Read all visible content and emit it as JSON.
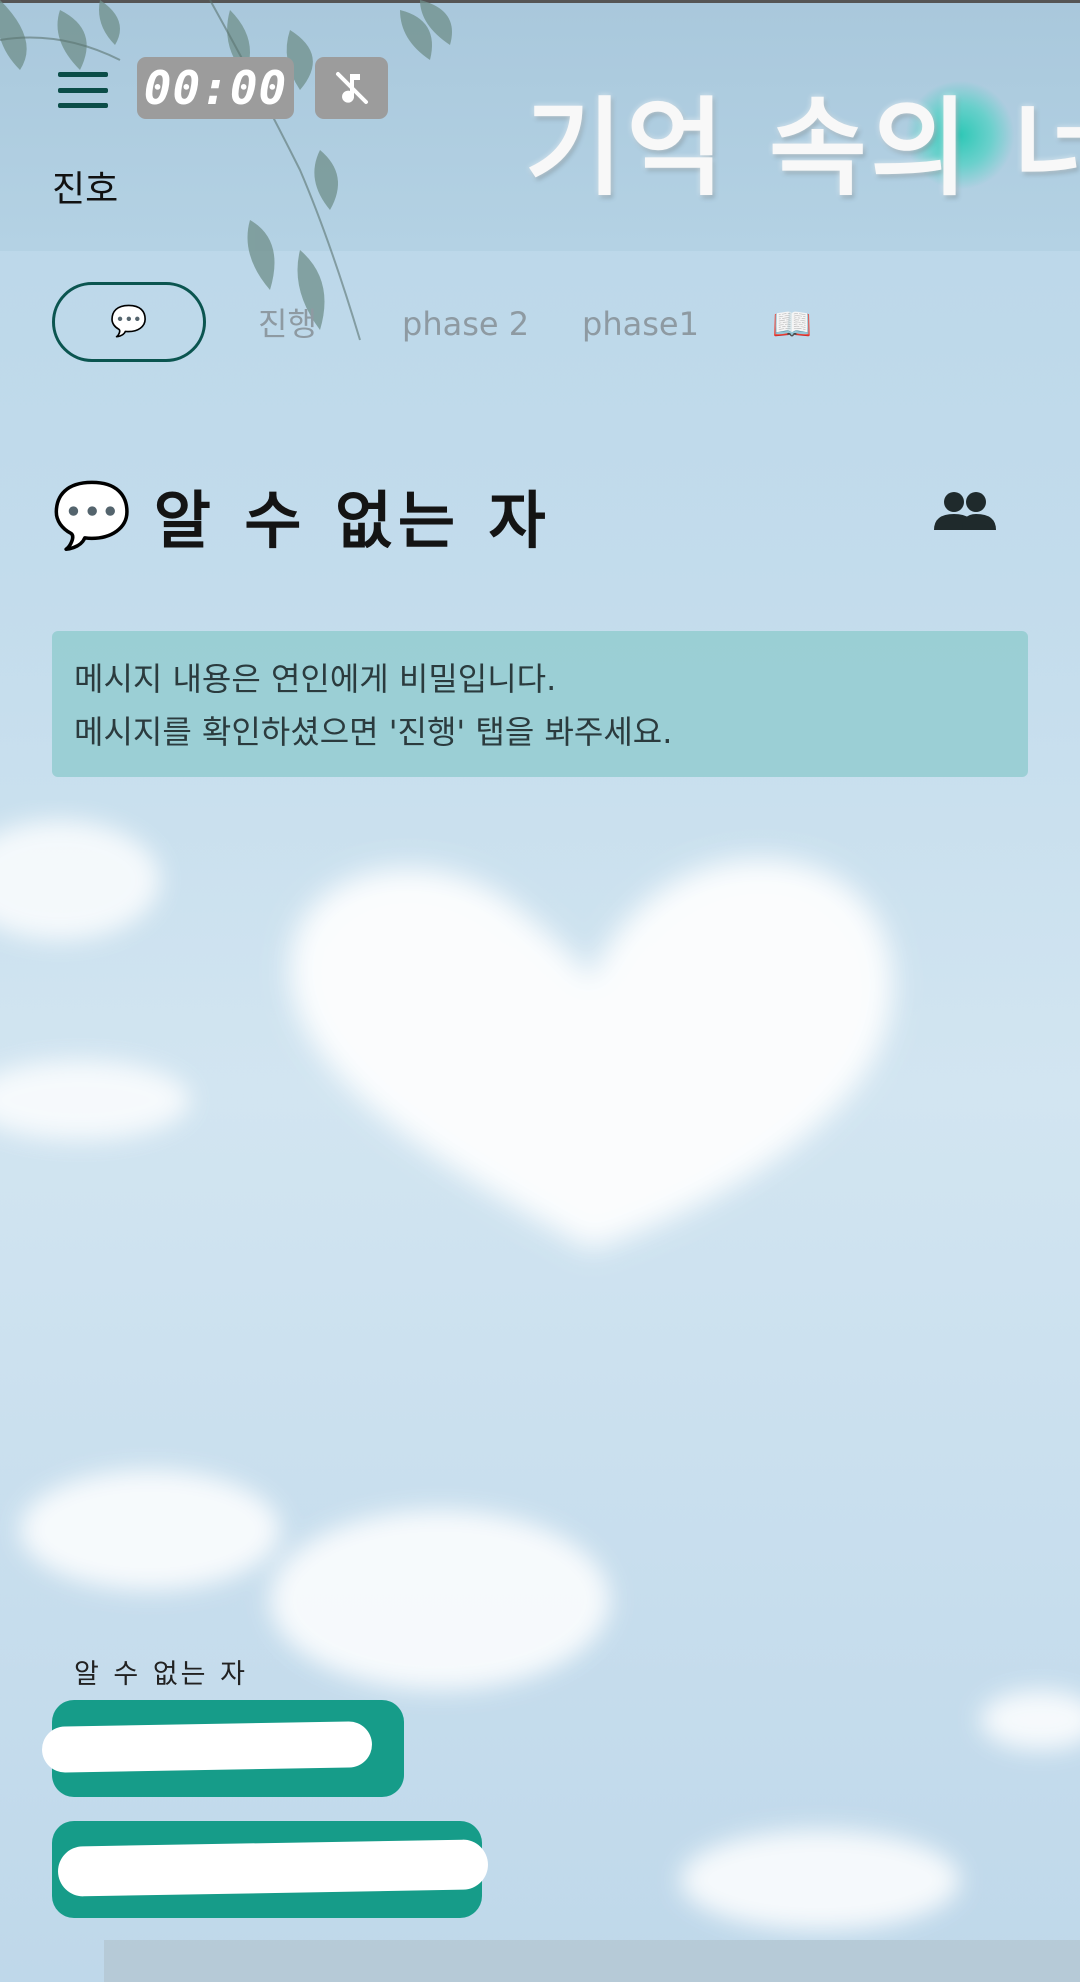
{
  "header": {
    "timer": "00:00",
    "user_name": "진호",
    "logo_text": "기억 속의 너"
  },
  "tabs": [
    {
      "label": "💬",
      "active": true
    },
    {
      "label": "진행"
    },
    {
      "label": "phase 2"
    },
    {
      "label": "phase1"
    },
    {
      "label": "📖"
    }
  ],
  "chat": {
    "title_icon": "💬",
    "title": "알 수 없는 자",
    "notice_line1": "메시지 내용은 연인에게 비밀입니다.",
    "notice_line2": "메시지를 확인하셨으면 '진행' 탭을 봐주세요.",
    "sender": "알 수 없는 자"
  },
  "colors": {
    "accent": "#0b5550",
    "bubble": "#169c89",
    "notice": "#96cdd2"
  }
}
